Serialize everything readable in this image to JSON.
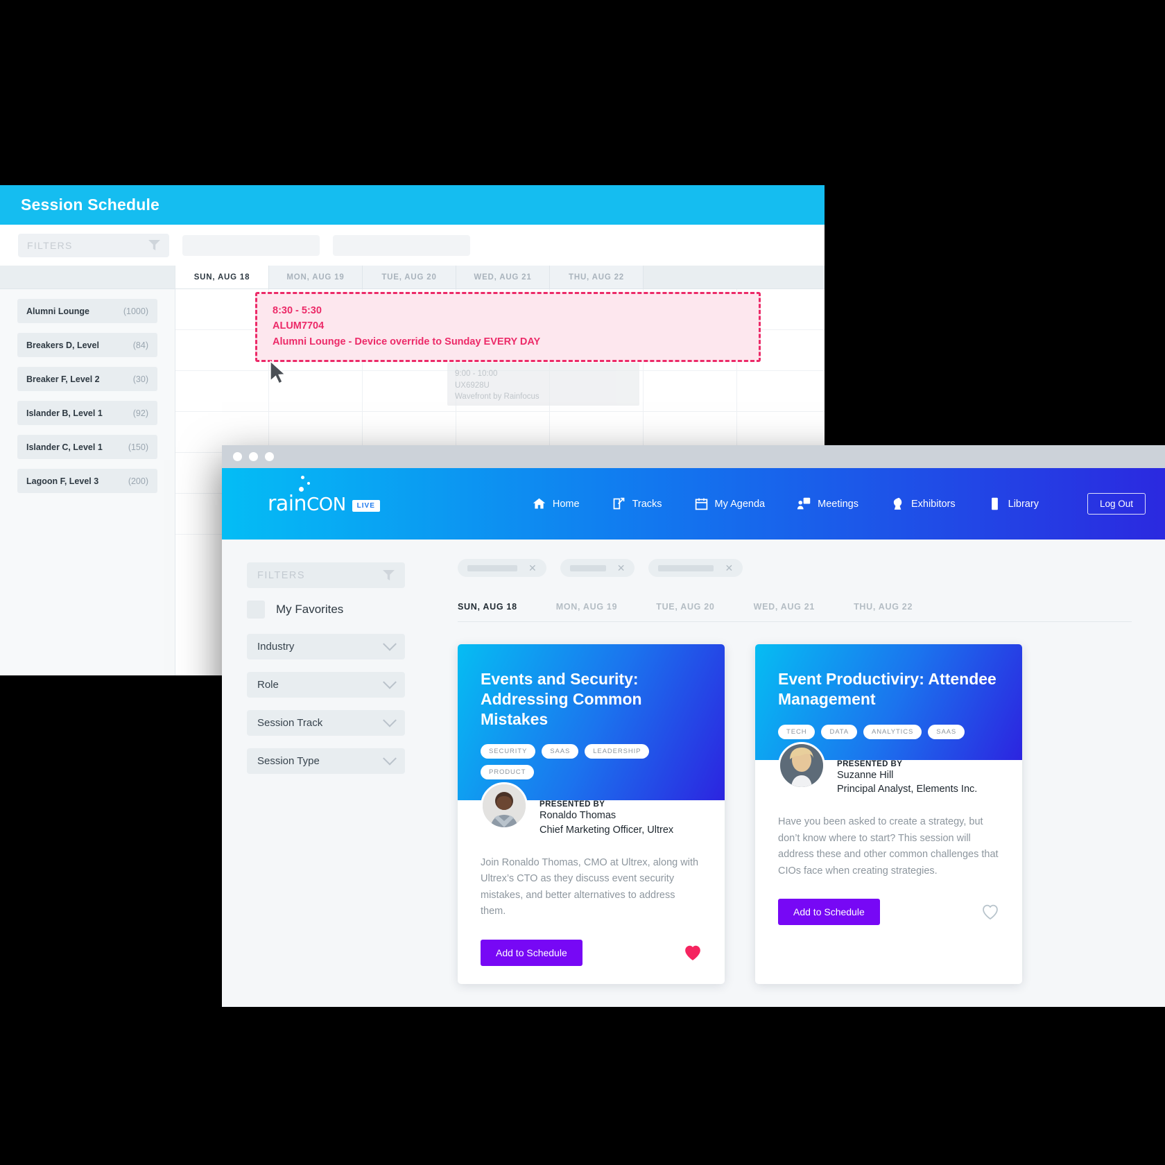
{
  "schedule_window": {
    "title": "Session Schedule",
    "filters": {
      "label": "FILTERS",
      "icon": "funnel-icon"
    },
    "day_tabs": [
      {
        "label": "SUN, AUG 18",
        "active": true
      },
      {
        "label": "MON, AUG 19",
        "active": false
      },
      {
        "label": "TUE, AUG 20",
        "active": false
      },
      {
        "label": "WED, AUG 21",
        "active": false
      },
      {
        "label": "THU, AUG 22",
        "active": false
      }
    ],
    "rooms": [
      {
        "name": "Alumni Lounge",
        "capacity": "(1000)"
      },
      {
        "name": "Breakers D, Level",
        "capacity": "(84)"
      },
      {
        "name": "Breaker F, Level 2",
        "capacity": "(30)"
      },
      {
        "name": "Islander B, Level 1",
        "capacity": "(92)"
      },
      {
        "name": "Islander C, Level 1",
        "capacity": "(150)"
      },
      {
        "name": "Lagoon F, Level 3",
        "capacity": "(200)"
      }
    ],
    "ghost_session": {
      "time": "9:00 - 10:00",
      "code": "UX6928U",
      "name": "Wavefront by Rainfocus"
    },
    "callout": {
      "time": "8:30 - 5:30",
      "code": "ALUM7704",
      "description": "Alumni Lounge - Device override to Sunday EVERY DAY",
      "color": "#ec2a68",
      "fill": "#fde7ee"
    }
  },
  "app_window": {
    "brand": {
      "word_lower": "rain",
      "word_upper": "CON",
      "badge": "LIVE"
    },
    "nav": [
      {
        "label": "Home",
        "icon": "home-icon"
      },
      {
        "label": "Tracks",
        "icon": "edit-square-icon"
      },
      {
        "label": "My Agenda",
        "icon": "calendar-icon"
      },
      {
        "label": "Meetings",
        "icon": "meetings-icon"
      },
      {
        "label": "Exhibitors",
        "icon": "exhibitors-icon"
      },
      {
        "label": "Library",
        "icon": "book-icon"
      }
    ],
    "logout_label": "Log Out",
    "sidebar": {
      "filters_label": "FILTERS",
      "favorites_label": "My Favorites",
      "groups": [
        {
          "label": "Industry"
        },
        {
          "label": "Role"
        },
        {
          "label": "Session Track"
        },
        {
          "label": "Session Type"
        }
      ]
    },
    "day_tabs": [
      {
        "label": "SUN, AUG 18",
        "active": true
      },
      {
        "label": "MON, AUG 19",
        "active": false
      },
      {
        "label": "TUE, AUG 20",
        "active": false
      },
      {
        "label": "WED, AUG 21",
        "active": false
      },
      {
        "label": "THU, AUG 22",
        "active": false
      }
    ],
    "cards": [
      {
        "title": "Events and Security: Addressing Common Mistakes",
        "tags": [
          "SECURITY",
          "SAAS",
          "LEADERSHIP",
          "PRODUCT"
        ],
        "presented_by_label": "PRESENTED BY",
        "presenter_name": "Ronaldo Thomas",
        "presenter_role": "Chief Marketing Officer, Ultrex",
        "description": "Join Ronaldo Thomas, CMO at Ultrex, along with Ultrex’s CTO as they discuss event security mistakes, and better alternatives to address them.",
        "button_label": "Add to Schedule",
        "favorited": true
      },
      {
        "title": "Event Productiviry: Attendee Management",
        "tags": [
          "TECH",
          "DATA",
          "ANALYTICS",
          "SAAS"
        ],
        "presented_by_label": "PRESENTED BY",
        "presenter_name": "Suzanne Hill",
        "presenter_role": "Principal Analyst, Elements Inc.",
        "description": "Have you been asked to create a strategy, but don’t know where to start? This session will address these and other common challenges that CIOs face when creating strategies.",
        "button_label": "Add to Schedule",
        "favorited": false
      }
    ],
    "accent_button_color": "#7708f5",
    "favorite_color": "#f5245f"
  }
}
